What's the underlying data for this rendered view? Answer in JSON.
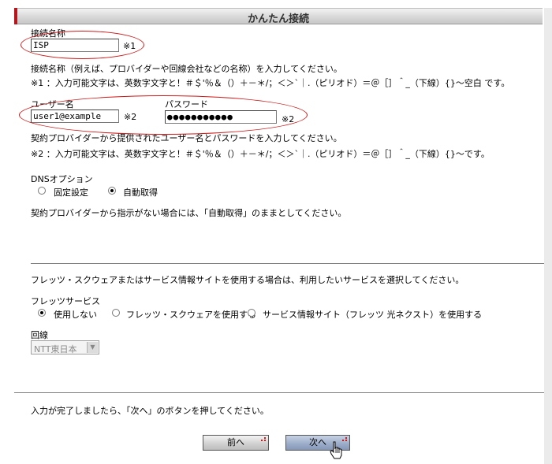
{
  "header": {
    "title": "かんたん接続"
  },
  "connection_name": {
    "label": "接続名称",
    "value": "ISP",
    "note_mark": "※1",
    "help": "接続名称（例えば、プロバイダーや回線会社などの名称）を入力してください。",
    "rule": "※1 ：入力可能文字は、英数字文字と！＃＄'％＆（）＋－＊/；＜＞`｜.（ピリオド）＝＠［］＾_（下線）{}～空白 です。"
  },
  "credentials": {
    "user_label": "ユーザー名",
    "user_value": "user1@example",
    "password_label": "パスワード",
    "password_value": "●●●●●●●●●●●",
    "note_mark_user": "※2",
    "note_mark_pass": "※2",
    "help": "契約プロバイダーから提供されたユーザー名とパスワードを入力してください。",
    "rule": "※2 ：入力可能文字は、英数字文字と！＃＄'％＆（）＋－＊/；＜＞`｜.（ピリオド）＝＠［］＾_（下線）{}～です。"
  },
  "dns": {
    "label": "DNSオプション",
    "options": [
      "固定設定",
      "自動取得"
    ],
    "selected": "自動取得",
    "help": "契約プロバイダーから指示がない場合には、「自動取得」のままとしてください。"
  },
  "flets": {
    "intro": "フレッツ・スクウェアまたはサービス情報サイトを使用する場合は、利用したいサービスを選択してください。",
    "label": "フレッツサービス",
    "options": [
      "使用しない",
      "フレッツ・スクウェアを使用する",
      "サービス情報サイト（フレッツ 光ネクスト）を使用する"
    ],
    "selected": "使用しない",
    "line_label": "回線",
    "line_value": "NTT東日本"
  },
  "footer": {
    "text": "入力が完了しましたら、「次へ」のボタンを押してください。",
    "back_label": "前へ",
    "next_label": "次へ"
  },
  "colors": {
    "accent": "#b8141b",
    "highlight_ellipse": "#d01818",
    "next_button": "#9aabc8"
  }
}
